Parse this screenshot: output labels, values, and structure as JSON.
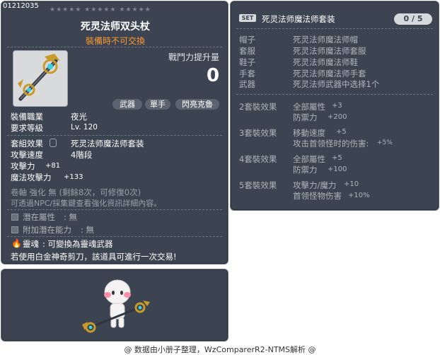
{
  "item": {
    "id": "01212035",
    "stars": "★★★★★  ★★★★★  ★★★★★",
    "name": "死灵法师双头杖",
    "trade_note": "裝備時不可交換",
    "power_label": "戰鬥力提升量",
    "power_value": "0",
    "job_tags": [
      "武器",
      "單手",
      "閃亮克魯"
    ],
    "job_label": "裝備職業",
    "job_value": "夜光",
    "level_label": "要求等級",
    "level_value": "Lv. 120",
    "set_label": "套組效果",
    "set_value": "死灵法师魔法师套装",
    "speed_label": "攻擊速度",
    "speed_value": "4階段",
    "attack_label": "攻擊力",
    "attack_value": "+81",
    "magic_label": "魔法攻擊力",
    "magic_value": "+133",
    "scroll_text": "卷軸 強化 無 (剩餘8次，可修復0次)",
    "npc_text": "可透過NPC/採集鍵查看強化資訊詳細內容。",
    "potential_label": "潛在屬性",
    "potential_value": ": 無",
    "bonus_potential_label": "附加潛在能力",
    "bonus_potential_value": ": 無",
    "soul_label": "靈魂",
    "soul_value": ": 可變換為靈魂武器",
    "scissors_text": "若使用白金神奇剪刀，該道具可進行一次交易!"
  },
  "set": {
    "badge": "SET",
    "title": "死灵法师魔法师套装",
    "count": "0 / 5",
    "pieces": [
      {
        "slot": "帽子",
        "name": "死灵法师魔法师帽"
      },
      {
        "slot": "套服",
        "name": "死灵法师魔法师套服"
      },
      {
        "slot": "鞋子",
        "name": "死灵法师魔法师鞋"
      },
      {
        "slot": "手套",
        "name": "死灵法师魔法师手套"
      },
      {
        "slot": "武器",
        "name": "死灵法师武器中选择1个"
      }
    ],
    "effects": [
      {
        "title": "2套裝效果",
        "lines": [
          [
            "全部屬性",
            "+3"
          ],
          [
            "防禦力",
            "+200"
          ]
        ]
      },
      {
        "title": "3套裝效果",
        "lines": [
          [
            "移動速度",
            "+5"
          ],
          [
            "攻击首领怪时的伤害:",
            "+5%"
          ]
        ]
      },
      {
        "title": "4套裝效果",
        "lines": [
          [
            "全部屬性",
            "+5"
          ],
          [
            "防禦力",
            "+100"
          ]
        ]
      },
      {
        "title": "5套裝效果",
        "lines": [
          [
            "攻擊力/魔力",
            "+10"
          ],
          [
            "首领怪物伤害",
            "+10%"
          ]
        ]
      }
    ]
  },
  "footer": "@ 数据由小册子整理，WzComparerR2-NTMS解析 @",
  "colors": {
    "panel": "#3b4450",
    "trade_note": "#ff9933",
    "footer": "#333333"
  }
}
